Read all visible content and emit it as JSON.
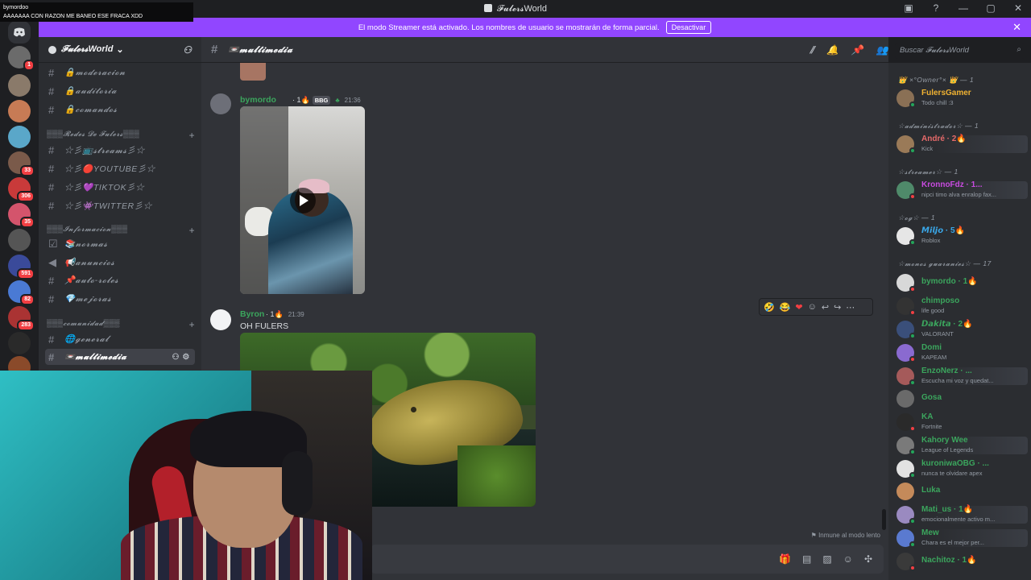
{
  "app": {
    "title": "𝓕𝓾𝓵𝓮𝓻𝓼World"
  },
  "chat_overlay": {
    "user": "bymordoo",
    "message": "AAAAAAA CON RAZON ME BANEO ESE FRACA XDD"
  },
  "banner": {
    "text": "El modo Streamer está activado. Los nombres de usuario se mostrarán de forma parcial.",
    "button": "Desactivar",
    "close": "✕"
  },
  "guilds": {
    "badges": [
      "1",
      "33",
      "306",
      "35",
      "591",
      "82",
      "283"
    ],
    "colors": [
      "#6b6b6b",
      "#8a7a6a",
      "#c77b55",
      "#5aa7c9",
      "#7a5a4a",
      "#c93a3a",
      "#d4546c",
      "#555",
      "#3a4a9a",
      "#4a7ad4",
      "#a33",
      "#2a2a2a",
      "#8a4a2a"
    ]
  },
  "server": {
    "name": "𝓕𝓾𝓵𝓮𝓻𝓼World"
  },
  "channels": {
    "items": [
      {
        "label": "🔒𝓶𝓸𝓭𝓮𝓻𝓪𝓬𝓲𝓸𝓷"
      },
      {
        "label": "🔒𝓪𝓾𝓭𝓲𝓽𝓸𝓻𝓲𝓪"
      },
      {
        "label": "🔒𝓬𝓸𝓶𝓪𝓷𝓭𝓸𝓼"
      },
      {
        "label": "☆彡📺𝓼𝓽𝓻𝓮𝓪𝓶𝓼彡☆"
      },
      {
        "label": "☆彡🔴YOUTUBE彡☆"
      },
      {
        "label": "☆彡💜TIKTOK彡☆"
      },
      {
        "label": "☆彡👾TWITTER彡☆"
      },
      {
        "label": "📚𝓷𝓸𝓻𝓶𝓪𝓼"
      },
      {
        "label": "📢𝓪𝓷𝓾𝓷𝓬𝓲𝓸𝓼"
      },
      {
        "label": "📌𝓪𝓾𝓽𝓸-𝓻𝓸𝓵𝓮𝓼"
      },
      {
        "label": "💎𝓶𝓮𝓳𝓸𝓻𝓪𝓼"
      },
      {
        "label": "🌐𝓰𝓮𝓷𝓮𝓻𝓪𝓵"
      },
      {
        "label": "📼𝓶𝓾𝓵𝓽𝓲𝓶𝓮𝓭𝓲𝓪"
      }
    ],
    "categories": [
      "▒▒▒𝓡𝓮𝓭𝓮𝓼 𝓓𝓮 𝓕𝓾𝓵𝓮𝓻𝓼▒▒▒",
      "▒▒▒𝓘𝓷𝓯𝓸𝓻𝓶𝓪𝓬𝓲𝓸𝓷▒▒▒",
      "▒▒▒𝓬𝓸𝓶𝓾𝓷𝓲𝓭𝓪𝓭▒▒▒"
    ]
  },
  "header": {
    "channel": "📼𝓶𝓾𝓵𝓽𝓲𝓶𝓮𝓭𝓲𝓪",
    "search_placeholder": "Buscar 𝓕𝓾𝓵𝓮𝓻𝓼World"
  },
  "messages": [
    {
      "author": "bymordo",
      "meta": "· 1🔥",
      "tag": "BBG",
      "time": "21:36",
      "color": "#3ba55d"
    },
    {
      "author": "Byron",
      "meta": "· 1🔥",
      "time": "21:39",
      "text": "OH FULERS",
      "color": "#3ba55d"
    }
  ],
  "hover_bar": [
    "🤣",
    "😂",
    "❤",
    "☺",
    "↩",
    "↪",
    "⋯"
  ],
  "composer": {
    "slowmode": "Inmune al modo lento"
  },
  "members": {
    "categories": [
      "👑 ×°Owner°× 👑 — 1",
      "☆𝓪𝓭𝓶𝓲𝓷𝓲𝓼𝓽𝓻𝓪𝓭𝓸𝓻☆ — 1",
      "☆𝓼𝓽𝓻𝓮𝓪𝓶𝓮𝓻☆ — 1",
      "☆𝓸𝓰☆ — 1",
      "☆𝓶𝓸𝓷𝓸𝓼 𝓰𝓾𝓪𝓻𝓪𝓷𝓲𝓮𝓼☆ — 17"
    ],
    "list": [
      {
        "name": "FulersGamer",
        "sub": "Todo chill :3",
        "color": "#f0b232"
      },
      {
        "name": "André · 2🔥",
        "sub": "Kick",
        "color": "#e66a6a"
      },
      {
        "name": "KronnoFdz · 1...",
        "sub": "nipci timo alva enralop fax...",
        "color": "#c84be0"
      },
      {
        "name": "𝙈𝙞𝙡𝙟𝙤 · 5🔥",
        "sub": "Roblox",
        "color": "#3aa7e8"
      },
      {
        "name": "bymordo · 1🔥",
        "sub": "",
        "color": "#3ba55d"
      },
      {
        "name": "chimposo",
        "sub": "life good",
        "color": "#3ba55d"
      },
      {
        "name": "𝘿𝙖𝙠𝙞𝙩𝙖 · 2🔥",
        "sub": "VALORANT",
        "color": "#3ba55d"
      },
      {
        "name": "Domi",
        "sub": "KAPEAM",
        "color": "#3ba55d"
      },
      {
        "name": "EnzoNerz · ...",
        "sub": "Escucha mi voz y quedat...",
        "color": "#3ba55d"
      },
      {
        "name": "Gosa",
        "sub": "",
        "color": "#3ba55d"
      },
      {
        "name": "KA",
        "sub": "Fortnite",
        "color": "#3ba55d"
      },
      {
        "name": "Kahory Wee",
        "sub": "League of Legends",
        "color": "#3ba55d"
      },
      {
        "name": "kuroniwaOBG · ...",
        "sub": "nunca te olvidare apex",
        "color": "#3ba55d"
      },
      {
        "name": "Luka",
        "sub": "",
        "color": "#3ba55d"
      },
      {
        "name": "Mati_us · 1🔥",
        "sub": "emocionalmente activo m...",
        "color": "#3ba55d"
      },
      {
        "name": "Mew",
        "sub": "Chara es el mejor per...",
        "color": "#3ba55d"
      },
      {
        "name": "Nachitoz · 1🔥",
        "sub": "",
        "color": "#3ba55d"
      }
    ]
  }
}
